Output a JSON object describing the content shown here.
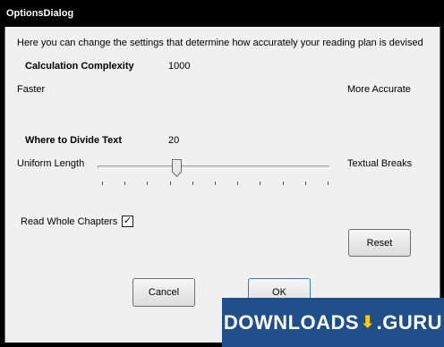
{
  "window": {
    "title": "OptionsDialog"
  },
  "intro": "Here you can change the settings that determine how accurately your reading plan is devised",
  "complexity": {
    "label": "Calculation Complexity",
    "value": "1000",
    "min_label": "Faster",
    "max_label": "More Accurate"
  },
  "divide": {
    "label": "Where to Divide Text",
    "value": "20",
    "min_label": "Uniform Length",
    "max_label": "Textual Breaks",
    "slider_position_fraction": 0.34
  },
  "chapters": {
    "label": "Read Whole Chapters",
    "checked": true,
    "check_glyph": "✓"
  },
  "buttons": {
    "reset": "Reset",
    "cancel": "Cancel",
    "ok": "OK"
  },
  "watermark": {
    "part1": "DOWNLOADS",
    "part2": ".GURU"
  }
}
